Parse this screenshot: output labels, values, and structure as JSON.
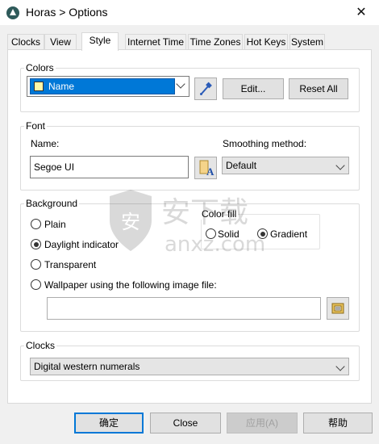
{
  "window": {
    "title": "Horas > Options",
    "close_glyph": "✕"
  },
  "tabs": [
    {
      "label": "Clocks"
    },
    {
      "label": "View"
    },
    {
      "label": "Style",
      "active": true
    },
    {
      "label": "Internet Time"
    },
    {
      "label": "Time Zones"
    },
    {
      "label": "Hot Keys"
    },
    {
      "label": "System"
    }
  ],
  "colors_group": {
    "label": "Colors",
    "selected_item": "Name",
    "swatch_color": "#fff9a8",
    "edit_label": "Edit...",
    "reset_all_label": "Reset All",
    "picker_icon": "eyedropper-icon"
  },
  "font_group": {
    "label": "Font",
    "name_label": "Name:",
    "name_value": "Segoe UI",
    "font_icon": "font-icon",
    "smoothing_label": "Smoothing method:",
    "smoothing_value": "Default"
  },
  "background_group": {
    "label": "Background",
    "options": [
      {
        "label": "Plain",
        "selected": false
      },
      {
        "label": "Daylight indicator",
        "selected": true
      },
      {
        "label": "Transparent",
        "selected": false
      },
      {
        "label": "Wallpaper using the following image file:",
        "selected": false
      }
    ],
    "wallpaper_path": "",
    "browse_icon": "folder-open-icon",
    "color_fill": {
      "label": "Color fill",
      "options": [
        {
          "label": "Solid",
          "selected": false
        },
        {
          "label": "Gradient",
          "selected": true
        }
      ]
    }
  },
  "clocks_group": {
    "label": "Clocks",
    "value": "Digital western numerals"
  },
  "footer": {
    "ok_label": "确定",
    "close_label": "Close",
    "apply_label": "应用(A)",
    "help_label": "帮助"
  },
  "watermark": {
    "text": "安下载",
    "sub": "anxz.com"
  },
  "accent": "#0078d7"
}
